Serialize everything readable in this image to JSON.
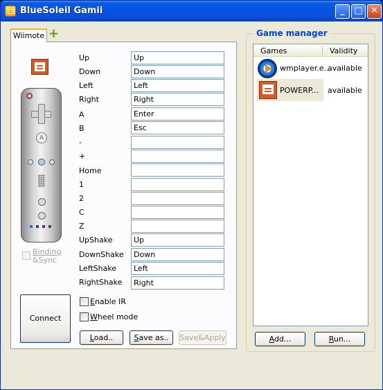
{
  "window": {
    "title": "BlueSoleil Gamii",
    "minimize": "_",
    "maximize": "□",
    "close": "✕"
  },
  "tabs": [
    {
      "label": "Wiimote"
    }
  ],
  "add_tab_glyph": "+",
  "binding": {
    "line1": "Binding",
    "line2": "&Sync"
  },
  "mappings": [
    {
      "label": "Up",
      "value": "Up"
    },
    {
      "label": "Down",
      "value": "Down"
    },
    {
      "label": "Left",
      "value": "Left"
    },
    {
      "label": "Right",
      "value": "Right"
    },
    {
      "label": "A",
      "value": "Enter"
    },
    {
      "label": "B",
      "value": "Esc"
    },
    {
      "label": "-",
      "value": ""
    },
    {
      "label": "+",
      "value": ""
    },
    {
      "label": "Home",
      "value": ""
    },
    {
      "label": "1",
      "value": ""
    },
    {
      "label": "2",
      "value": ""
    },
    {
      "label": "C",
      "value": ""
    },
    {
      "label": "Z",
      "value": ""
    },
    {
      "label": "UpShake",
      "value": "Up"
    },
    {
      "label": "DownShake",
      "value": "Down"
    },
    {
      "label": "LeftShake",
      "value": "Left"
    },
    {
      "label": "RightShake",
      "value": "Right"
    }
  ],
  "wiimote_buttons": {
    "a": "A"
  },
  "connect_label": "Connect",
  "options": {
    "enable_ir": {
      "mnemonic": "E",
      "rest": "nable IR"
    },
    "wheel_mode": {
      "mnemonic": "W",
      "rest": "heel mode"
    }
  },
  "buttons": {
    "load": {
      "mnemonic": "L",
      "rest": "oad.."
    },
    "save_as": {
      "mnemonic": "S",
      "rest": "ave as.."
    },
    "save_apply": "Save&Apply"
  },
  "game_manager": {
    "title": "Game manager",
    "columns": [
      "Games",
      "Validity"
    ],
    "rows": [
      {
        "name": "wmplayer.e...",
        "validity": "available",
        "icon": "windows-media-player-icon"
      },
      {
        "name": "POWERP...",
        "validity": "available",
        "icon": "powerpoint-icon"
      }
    ],
    "add": {
      "mnemonic": "A",
      "rest": "dd..."
    },
    "run": {
      "mnemonic": "R",
      "rest": "un..."
    }
  }
}
